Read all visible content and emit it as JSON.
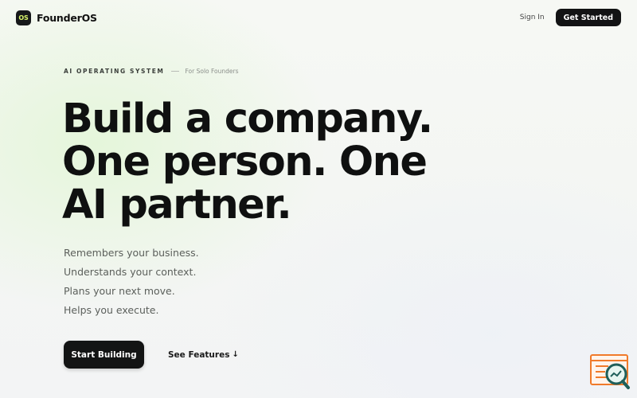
{
  "nav": {
    "logo_badge": "OS",
    "brand_name": "FounderOS",
    "sign_in": "Sign In",
    "get_started": "Get Started"
  },
  "hero": {
    "eyebrow_main": "AI OPERATING SYSTEM",
    "eyebrow_sub": "For Solo Founders",
    "headline": [
      "Build a company.",
      "One person. One",
      "AI partner."
    ],
    "features": [
      "Remembers your business.",
      "Understands your context.",
      "Plans your next move.",
      "Helps you execute."
    ],
    "primary_cta": "Start Building",
    "secondary_cta": "See Features",
    "secondary_cta_icon": "↓"
  },
  "icons": {
    "widget": "search-analytics-icon",
    "accent": "#f07a2a",
    "widget_dark": "#1f5f5a"
  },
  "colors": {
    "brand_dark": "#121314",
    "logo_text": "#d8f56a"
  }
}
